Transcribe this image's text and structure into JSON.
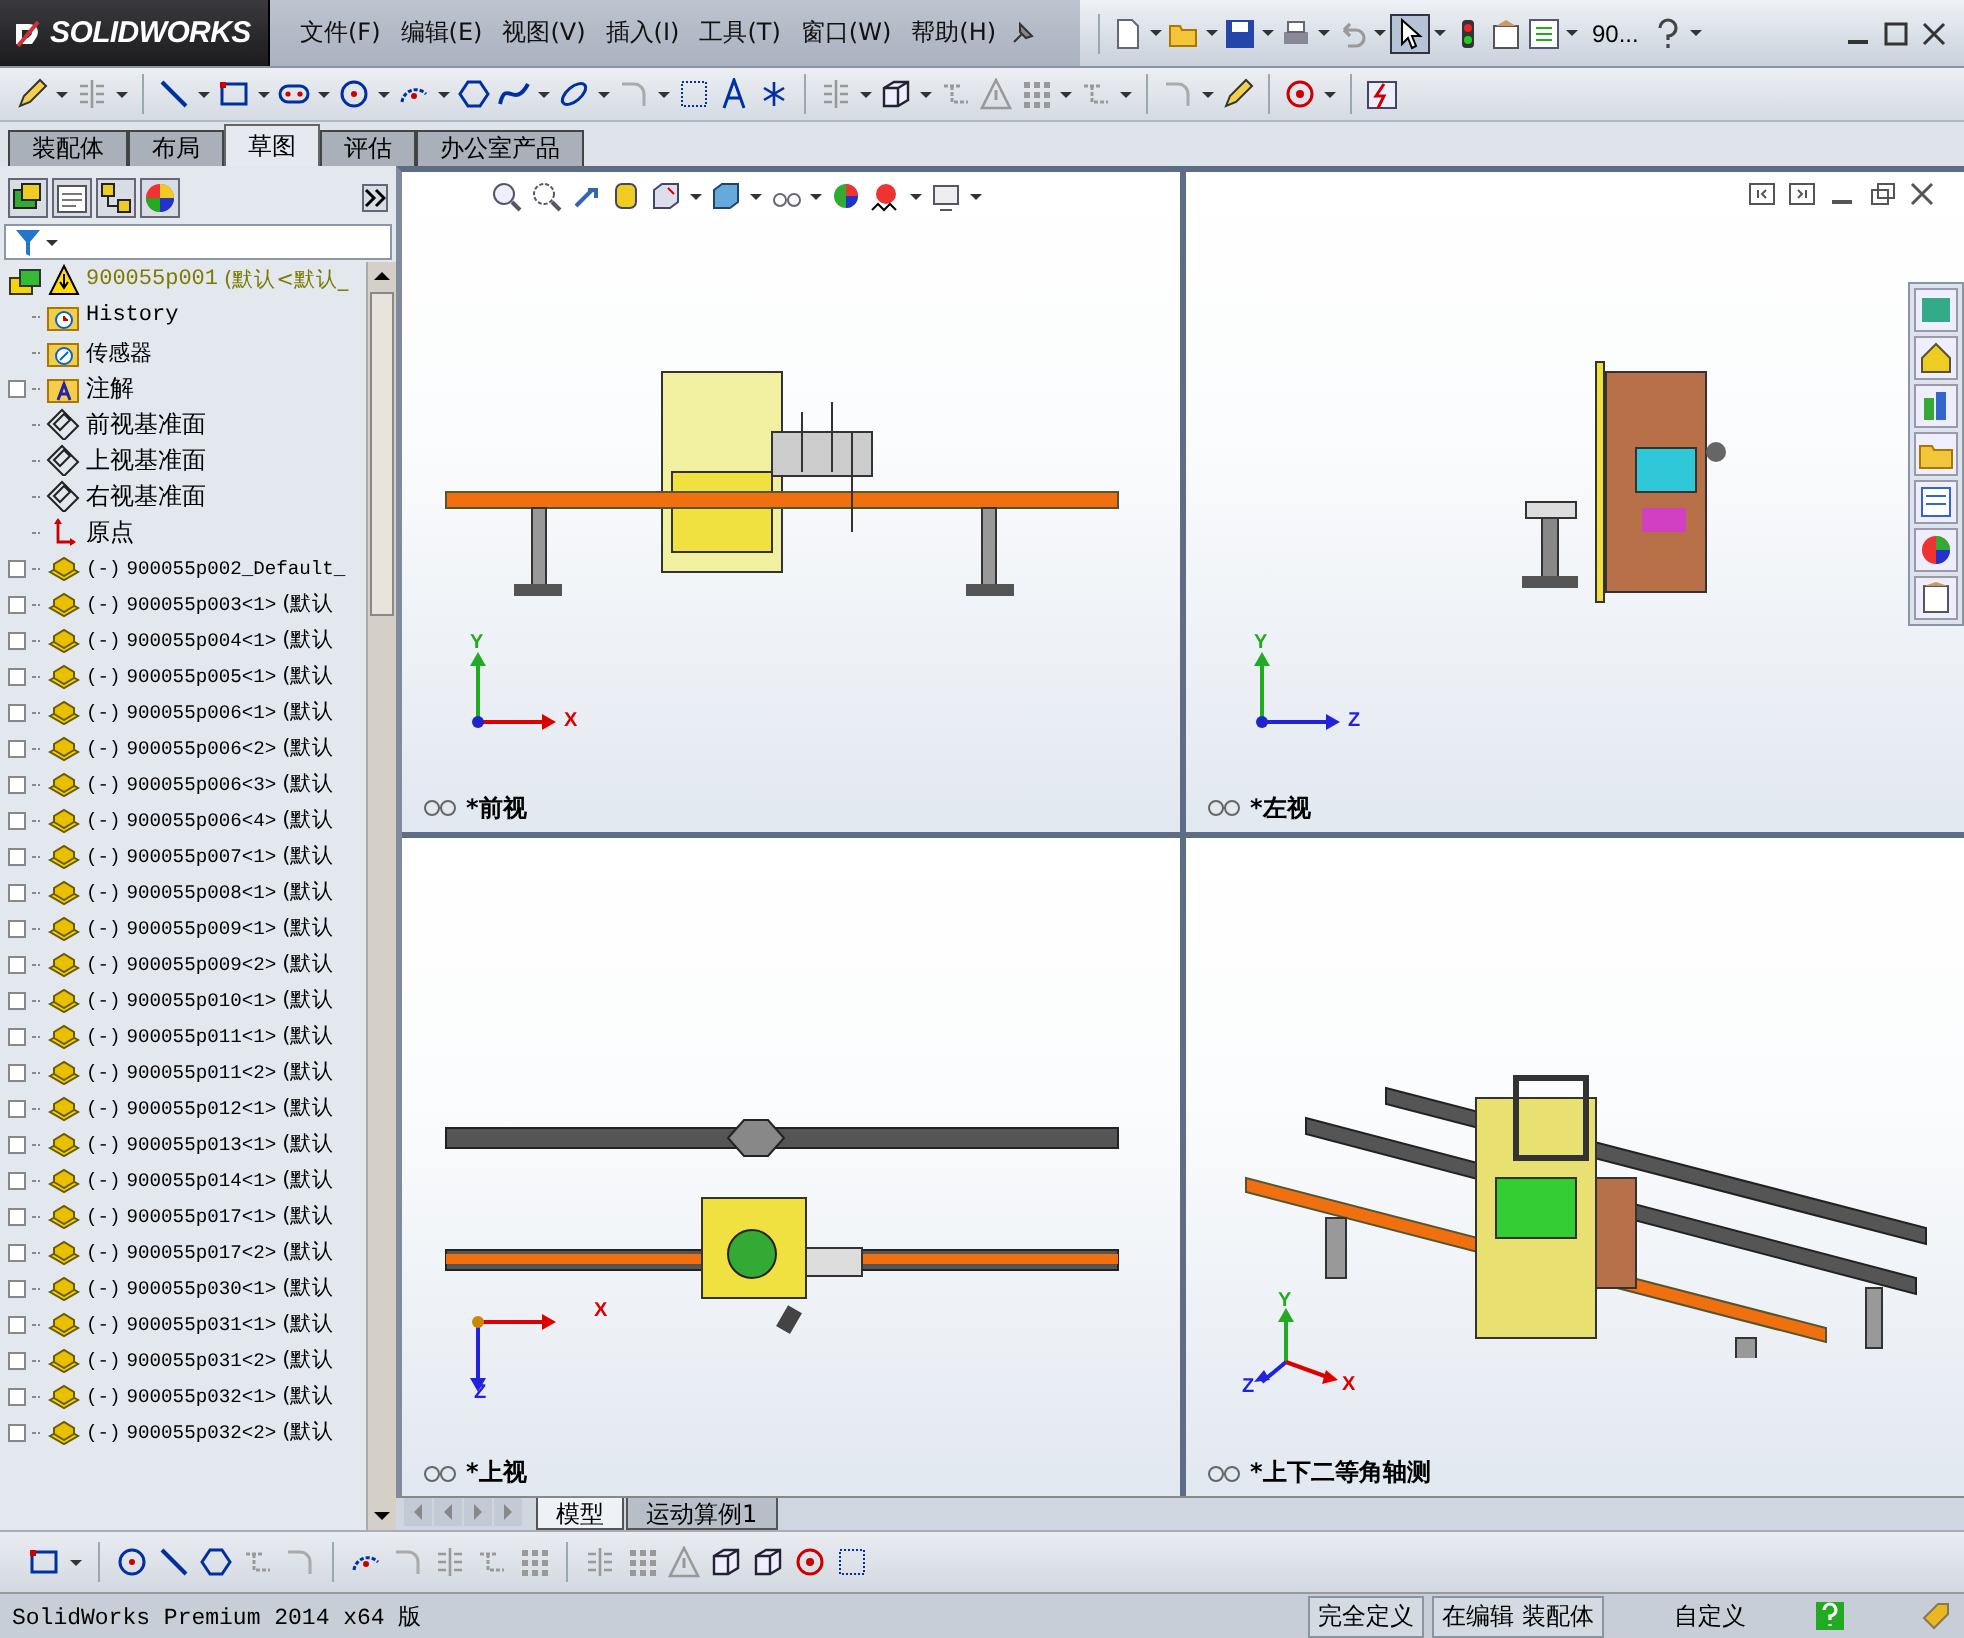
{
  "logo": "SOLIDWORKS",
  "menu": [
    "文件(F)",
    "编辑(E)",
    "视图(V)",
    "插入(I)",
    "工具(T)",
    "窗口(W)",
    "帮助(H)"
  ],
  "search_field": {
    "value": "90..."
  },
  "command_tabs": [
    {
      "label": "装配体",
      "selected": false
    },
    {
      "label": "布局",
      "selected": false
    },
    {
      "label": "草图",
      "selected": true
    },
    {
      "label": "评估",
      "selected": false
    },
    {
      "label": "办公室产品",
      "selected": false
    }
  ],
  "feature_tree": {
    "root": {
      "name": "900055p001",
      "config": "(默认<默认_"
    },
    "items": [
      {
        "kind": "history",
        "label": "History",
        "has_children": false
      },
      {
        "kind": "sensor",
        "label": "传感器",
        "has_children": false
      },
      {
        "kind": "annotation",
        "label": "注解",
        "has_children": true
      },
      {
        "kind": "plane",
        "label": "前视基准面",
        "has_children": false
      },
      {
        "kind": "plane",
        "label": "上视基准面",
        "has_children": false
      },
      {
        "kind": "plane",
        "label": "右视基准面",
        "has_children": false
      },
      {
        "kind": "origin",
        "label": "原点",
        "has_children": false
      },
      {
        "kind": "part",
        "state": "(-)",
        "label": "900055p002_Default_",
        "has_children": true
      },
      {
        "kind": "part",
        "state": "(-)",
        "label": "900055p003<1>",
        "config": "(默认",
        "has_children": true
      },
      {
        "kind": "part",
        "state": "(-)",
        "label": "900055p004<1>",
        "config": "(默认",
        "has_children": true
      },
      {
        "kind": "part",
        "state": "(-)",
        "label": "900055p005<1>",
        "config": "(默认",
        "has_children": true
      },
      {
        "kind": "part",
        "state": "(-)",
        "label": "900055p006<1>",
        "config": "(默认",
        "has_children": true
      },
      {
        "kind": "part",
        "state": "(-)",
        "label": "900055p006<2>",
        "config": "(默认",
        "has_children": true
      },
      {
        "kind": "part",
        "state": "(-)",
        "label": "900055p006<3>",
        "config": "(默认",
        "has_children": true
      },
      {
        "kind": "part",
        "state": "(-)",
        "label": "900055p006<4>",
        "config": "(默认",
        "has_children": true
      },
      {
        "kind": "part",
        "state": "(-)",
        "label": "900055p007<1>",
        "config": "(默认",
        "has_children": true
      },
      {
        "kind": "part",
        "state": "(-)",
        "label": "900055p008<1>",
        "config": "(默认",
        "has_children": true
      },
      {
        "kind": "part",
        "state": "(-)",
        "label": "900055p009<1>",
        "config": "(默认",
        "has_children": true
      },
      {
        "kind": "part",
        "state": "(-)",
        "label": "900055p009<2>",
        "config": "(默认",
        "has_children": true
      },
      {
        "kind": "part",
        "state": "(-)",
        "label": "900055p010<1>",
        "config": "(默认",
        "has_children": true
      },
      {
        "kind": "part",
        "state": "(-)",
        "label": "900055p011<1>",
        "config": "(默认",
        "has_children": true
      },
      {
        "kind": "part",
        "state": "(-)",
        "label": "900055p011<2>",
        "config": "(默认",
        "has_children": true
      },
      {
        "kind": "part",
        "state": "(-)",
        "label": "900055p012<1>",
        "config": "(默认",
        "has_children": true
      },
      {
        "kind": "part",
        "state": "(-)",
        "label": "900055p013<1>",
        "config": "(默认",
        "has_children": true
      },
      {
        "kind": "part",
        "state": "(-)",
        "label": "900055p014<1>",
        "config": "(默认",
        "has_children": true
      },
      {
        "kind": "part",
        "state": "(-)",
        "label": "900055p017<1>",
        "config": "(默认",
        "has_children": true
      },
      {
        "kind": "part",
        "state": "(-)",
        "label": "900055p017<2>",
        "config": "(默认",
        "has_children": true
      },
      {
        "kind": "part",
        "state": "(-)",
        "label": "900055p030<1>",
        "config": "(默认",
        "has_children": true
      },
      {
        "kind": "part",
        "state": "(-)",
        "label": "900055p031<1>",
        "config": "(默认",
        "has_children": true
      },
      {
        "kind": "part",
        "state": "(-)",
        "label": "900055p031<2>",
        "config": "(默认",
        "has_children": true
      },
      {
        "kind": "part",
        "state": "(-)",
        "label": "900055p032<1>",
        "config": "(默认",
        "has_children": true
      },
      {
        "kind": "part",
        "state": "(-)",
        "label": "900055p032<2>",
        "config": "(默认",
        "has_children": true
      }
    ]
  },
  "viewports": [
    {
      "label": "*前视",
      "kind": "front",
      "axes": [
        "Y",
        "X"
      ]
    },
    {
      "label": "*左视",
      "kind": "left",
      "axes": [
        "Y",
        "Z"
      ]
    },
    {
      "label": "*上视",
      "kind": "top",
      "axes": [
        "X",
        "Z"
      ]
    },
    {
      "label": "*上下二等角轴测",
      "kind": "iso",
      "axes": [
        "Y",
        "Z",
        "X"
      ]
    }
  ],
  "bottom_tabs": [
    {
      "label": "模型",
      "selected": true
    },
    {
      "label": "运动算例1",
      "selected": false
    }
  ],
  "status_bar": {
    "product": "SolidWorks Premium 2014 x64 版",
    "sections": [
      "完全定义",
      "在编辑 装配体",
      "自定义"
    ]
  }
}
